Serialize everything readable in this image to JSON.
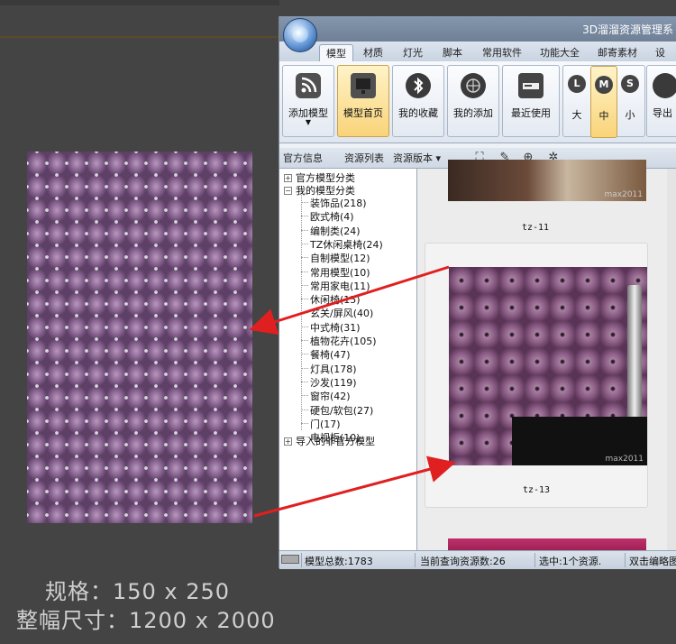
{
  "window": {
    "title": "3D溜溜资源管理系",
    "tabs": [
      "模型",
      "材质",
      "灯光",
      "脚本",
      "常用软件",
      "功能大全",
      "邮寄素材",
      "设置"
    ],
    "active_tab": 0
  },
  "ribbon": {
    "buttons": [
      {
        "label": "添加模型",
        "icon": "rss-icon",
        "has_dropdown": true
      },
      {
        "label": "模型首页",
        "icon": "monitor-icon",
        "active": true
      },
      {
        "label": "我的收藏",
        "icon": "bluetooth-icon"
      },
      {
        "label": "我的添加",
        "icon": "globe-icon"
      },
      {
        "label": "最近使用",
        "icon": "drive-icon"
      }
    ],
    "sizes": [
      {
        "key": "L",
        "label": "大"
      },
      {
        "key": "M",
        "label": "中",
        "active": true
      },
      {
        "key": "S",
        "label": "小"
      }
    ],
    "export_label": "导出"
  },
  "toolbar": {
    "items": [
      "官方信息",
      "资源列表",
      "资源版本 ▾"
    ],
    "icons": [
      "fullscreen-icon",
      "brush-icon",
      "zoom-in-icon",
      "settings-icon"
    ]
  },
  "tree": {
    "root_official": "官方模型分类",
    "root_mine": "我的模型分类",
    "children": [
      "装饰品(218)",
      "欧式椅(4)",
      "编制类(24)",
      "TZ休闲桌椅(24)",
      "自制模型(12)",
      "常用模型(10)",
      "常用家电(11)",
      "休闲椅(15)",
      "玄关/屏风(40)",
      "中式椅(31)",
      "植物花卉(105)",
      "餐椅(47)",
      "灯具(178)",
      "沙发(119)",
      "窗帘(42)",
      "硬包/软包(27)",
      "门(17)",
      "电视柜(10)"
    ],
    "root_imported": "导入的非官方模型"
  },
  "preview": {
    "items": [
      {
        "caption": "tz-11",
        "watermark": "max2011"
      },
      {
        "caption": "tz-13",
        "watermark": "max2011"
      }
    ]
  },
  "status": {
    "total": "模型总数:1783",
    "query": "当前查询资源数:26",
    "selected": "选中:1个资源.",
    "hint": "双击编略图"
  },
  "overlay": {
    "spec": "规格：150 x 250",
    "size": "整幅尺寸：1200 x 2000"
  },
  "colors": {
    "fabric": "#7a5a80",
    "arrow": "#e02020",
    "ribbon_active": "#f9d47a"
  }
}
